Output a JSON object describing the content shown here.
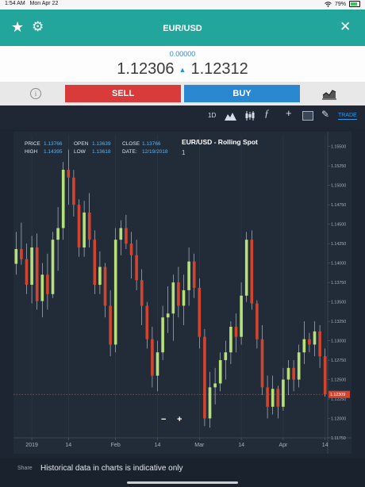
{
  "status_bar": {
    "time": "1:54 AM",
    "date": "Mon Apr 22",
    "battery": "79%"
  },
  "header": {
    "title": "EUR/USD",
    "favorite_icon": "star-icon",
    "settings_icon": "gear-icon",
    "close_icon": "close-icon"
  },
  "quote": {
    "change": "0.00000",
    "bid": "1.12306",
    "ask": "1.12312",
    "direction_icon": "triangle-up-icon"
  },
  "trade": {
    "sell_label": "SELL",
    "buy_label": "BUY",
    "info_icon": "info-icon",
    "chart_icon": "chart-line-icon"
  },
  "toolbar": {
    "timeframe": "1D",
    "trade_tab": "TRADE",
    "icons": [
      "mountain-chart-icon",
      "candlestick-icon",
      "function-icon",
      "crosshair-icon",
      "chat-box-icon",
      "pencil-icon"
    ]
  },
  "chart": {
    "title": "EUR/USD - Rolling Spot",
    "subtitle": "1",
    "ohlc": {
      "price_label": "PRICE",
      "price": "1.13766",
      "open_label": "OPEN",
      "open": "1.13639",
      "close_label": "CLOSE",
      "close": "1.13766",
      "high_label": "HIGH",
      "high": "1.14395",
      "low_label": "LOW",
      "low": "1.13618",
      "date_label": "DATE:",
      "date": "12/19/2018"
    },
    "current_price": "1.12309",
    "zoom_out": "−",
    "zoom_in": "+",
    "colors": {
      "up": "#b5e07a",
      "down": "#d2442f",
      "grid": "#2f3a48",
      "label": "#a7b1bc"
    }
  },
  "chart_data": {
    "type": "candlestick",
    "symbol": "EUR/USD",
    "ylim": [
      1.1175,
      1.1565
    ],
    "yticks": [
      "1.15500",
      "1.15250",
      "1.15000",
      "1.14750",
      "1.14500",
      "1.14250",
      "1.14000",
      "1.13750",
      "1.13500",
      "1.13250",
      "1.13000",
      "1.12750",
      "1.12500",
      "1.12250",
      "1.12000",
      "1.11750"
    ],
    "xticks": [
      {
        "label": "2019",
        "index": 3
      },
      {
        "label": "14",
        "index": 10
      },
      {
        "label": "Feb",
        "index": 19
      },
      {
        "label": "14",
        "index": 27
      },
      {
        "label": "Mar",
        "index": 35
      },
      {
        "label": "14",
        "index": 43
      },
      {
        "label": "Apr",
        "index": 51
      },
      {
        "label": "14",
        "index": 59
      }
    ],
    "current_price": 1.12309,
    "candles": [
      [
        1.1399,
        1.144,
        1.1385,
        1.1418
      ],
      [
        1.1418,
        1.1452,
        1.1398,
        1.1405
      ],
      [
        1.1405,
        1.1425,
        1.136,
        1.1372
      ],
      [
        1.1372,
        1.1435,
        1.1348,
        1.142
      ],
      [
        1.142,
        1.1438,
        1.134,
        1.1351
      ],
      [
        1.1351,
        1.14,
        1.133,
        1.1385
      ],
      [
        1.1385,
        1.1412,
        1.134,
        1.136
      ],
      [
        1.136,
        1.144,
        1.1355,
        1.143
      ],
      [
        1.143,
        1.1472,
        1.139,
        1.1445
      ],
      [
        1.1445,
        1.153,
        1.143,
        1.152
      ],
      [
        1.152,
        1.1546,
        1.1475,
        1.151
      ],
      [
        1.151,
        1.152,
        1.146,
        1.1475
      ],
      [
        1.1475,
        1.1482,
        1.1408,
        1.142
      ],
      [
        1.142,
        1.148,
        1.1408,
        1.1465
      ],
      [
        1.1465,
        1.149,
        1.142,
        1.143
      ],
      [
        1.143,
        1.1442,
        1.136,
        1.1372
      ],
      [
        1.1372,
        1.1415,
        1.136,
        1.1395
      ],
      [
        1.1395,
        1.14,
        1.133,
        1.1345
      ],
      [
        1.1345,
        1.1365,
        1.128,
        1.1295
      ],
      [
        1.1295,
        1.1445,
        1.1285,
        1.143
      ],
      [
        1.143,
        1.1455,
        1.141,
        1.1445
      ],
      [
        1.1445,
        1.1462,
        1.1418,
        1.1425
      ],
      [
        1.1425,
        1.144,
        1.138,
        1.141
      ],
      [
        1.141,
        1.143,
        1.1365,
        1.1378
      ],
      [
        1.1378,
        1.1392,
        1.132,
        1.1345
      ],
      [
        1.1345,
        1.135,
        1.129,
        1.1302
      ],
      [
        1.1302,
        1.1318,
        1.124,
        1.1255
      ],
      [
        1.1255,
        1.13,
        1.1235,
        1.1285
      ],
      [
        1.1285,
        1.1345,
        1.1275,
        1.133
      ],
      [
        1.133,
        1.137,
        1.131,
        1.1335
      ],
      [
        1.1335,
        1.1385,
        1.13,
        1.1375
      ],
      [
        1.1375,
        1.1395,
        1.133,
        1.1345
      ],
      [
        1.1345,
        1.1385,
        1.132,
        1.1365
      ],
      [
        1.1365,
        1.142,
        1.1345,
        1.1402
      ],
      [
        1.1402,
        1.1412,
        1.1355,
        1.1368
      ],
      [
        1.1368,
        1.138,
        1.129,
        1.1305
      ],
      [
        1.1305,
        1.1315,
        1.119,
        1.12
      ],
      [
        1.12,
        1.126,
        1.1188,
        1.124
      ],
      [
        1.124,
        1.1265,
        1.1218,
        1.1245
      ],
      [
        1.1245,
        1.1285,
        1.1235,
        1.1275
      ],
      [
        1.1275,
        1.13,
        1.125,
        1.1285
      ],
      [
        1.1285,
        1.1325,
        1.127,
        1.1318
      ],
      [
        1.1318,
        1.1335,
        1.1285,
        1.1305
      ],
      [
        1.1305,
        1.1375,
        1.1295,
        1.1358
      ],
      [
        1.1358,
        1.144,
        1.135,
        1.143
      ],
      [
        1.143,
        1.1442,
        1.134,
        1.1348
      ],
      [
        1.1348,
        1.1352,
        1.129,
        1.1302
      ],
      [
        1.1302,
        1.132,
        1.123,
        1.124
      ],
      [
        1.124,
        1.1255,
        1.12,
        1.1215
      ],
      [
        1.1215,
        1.1255,
        1.1205,
        1.1238
      ],
      [
        1.1238,
        1.1242,
        1.12,
        1.1215
      ],
      [
        1.1215,
        1.1265,
        1.121,
        1.125
      ],
      [
        1.125,
        1.1275,
        1.123,
        1.1265
      ],
      [
        1.1265,
        1.1275,
        1.1235,
        1.125
      ],
      [
        1.125,
        1.1295,
        1.124,
        1.1285
      ],
      [
        1.1285,
        1.1325,
        1.127,
        1.1302
      ],
      [
        1.1302,
        1.131,
        1.1285,
        1.1295
      ],
      [
        1.1295,
        1.1325,
        1.128,
        1.1312
      ],
      [
        1.1312,
        1.132,
        1.1265,
        1.128
      ],
      [
        1.128,
        1.129,
        1.1228,
        1.1231
      ]
    ]
  },
  "footer": {
    "share_label": "Share",
    "note": "Historical data in charts is indicative only"
  }
}
